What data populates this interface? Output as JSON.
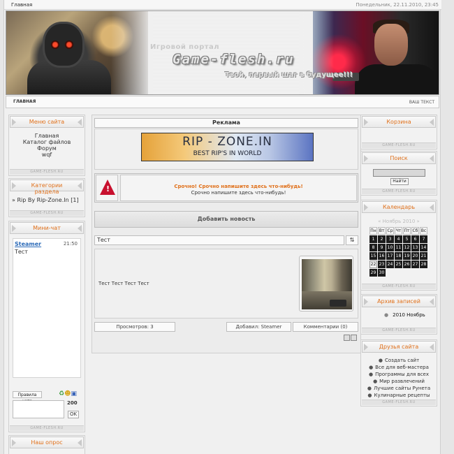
{
  "topbar": {
    "home": "Главная",
    "date": "Понедельник, 22.11.2010, 23:45"
  },
  "banner": {
    "subtitle": "Игровой портал",
    "logo": "Game-flesh.ru",
    "slogan": "Твой, первый шаг в будущее!!!"
  },
  "navbar": {
    "home": "ГЛАВНАЯ",
    "right": "ВАШ ТЕКСТ"
  },
  "footer_tag": "GAME-FLESH.RU",
  "left": {
    "menu": {
      "title": "Меню сайта",
      "items": [
        "Главная",
        "Каталог файлов",
        "Форум",
        "wqf"
      ]
    },
    "categories": {
      "title": "Категории раздела",
      "item": "Rip By Rip-Zone.In [1]"
    },
    "chat": {
      "title": "Мини-чат",
      "user": "Steamer",
      "time": "21:50",
      "message": "Тест",
      "rules": "Правила чата",
      "count": "200",
      "ok": "OK"
    },
    "poll": {
      "title": "Наш опрос"
    }
  },
  "center": {
    "ad": {
      "title": "Реклама",
      "banner_line1": "RIP - ZONE.IN",
      "banner_line2": "BEST RIP'S IN WORLD"
    },
    "alert": {
      "line1": "Срочно! Срочно напишите здесь что-нибудь!",
      "line2": "Срочно напишите здесь что-нибудь!"
    },
    "add_news": "Добавить новость",
    "post": {
      "title": "Тест",
      "sort_icon": "⇅",
      "text": "Тест Тест Тест Тест",
      "views": "Просмотров: 3",
      "author": "Добавил: Steamer",
      "comments": "Комментарии (0)"
    }
  },
  "right": {
    "cart": {
      "title": "Корзина"
    },
    "search": {
      "title": "Поиск",
      "button": "Найти"
    },
    "calendar": {
      "title": "Календарь",
      "nav": "«  Ноябрь 2010  »",
      "weekdays": [
        "Пн",
        "Вт",
        "Ср",
        "Чт",
        "Пт",
        "Сб",
        "Вс"
      ],
      "days": [
        "1",
        "2",
        "3",
        "4",
        "5",
        "6",
        "7",
        "8",
        "9",
        "10",
        "11",
        "12",
        "13",
        "14",
        "15",
        "16",
        "17",
        "18",
        "19",
        "20",
        "21",
        "22",
        "23",
        "24",
        "25",
        "26",
        "27",
        "28",
        "29",
        "30"
      ],
      "today": "22"
    },
    "archive": {
      "title": "Архив записей",
      "item": "2010 Ноябрь"
    },
    "friends": {
      "title": "Друзья сайта",
      "items": [
        "Создать сайт",
        "Все для веб-мастера",
        "Программы для всех",
        "Мир развлечений",
        "Лучшие сайты Рунета",
        "Кулинарные рецепты"
      ]
    }
  },
  "colors": {
    "accent": "#e0701a",
    "link": "#2b6ab8",
    "alert": "#c8102e"
  }
}
